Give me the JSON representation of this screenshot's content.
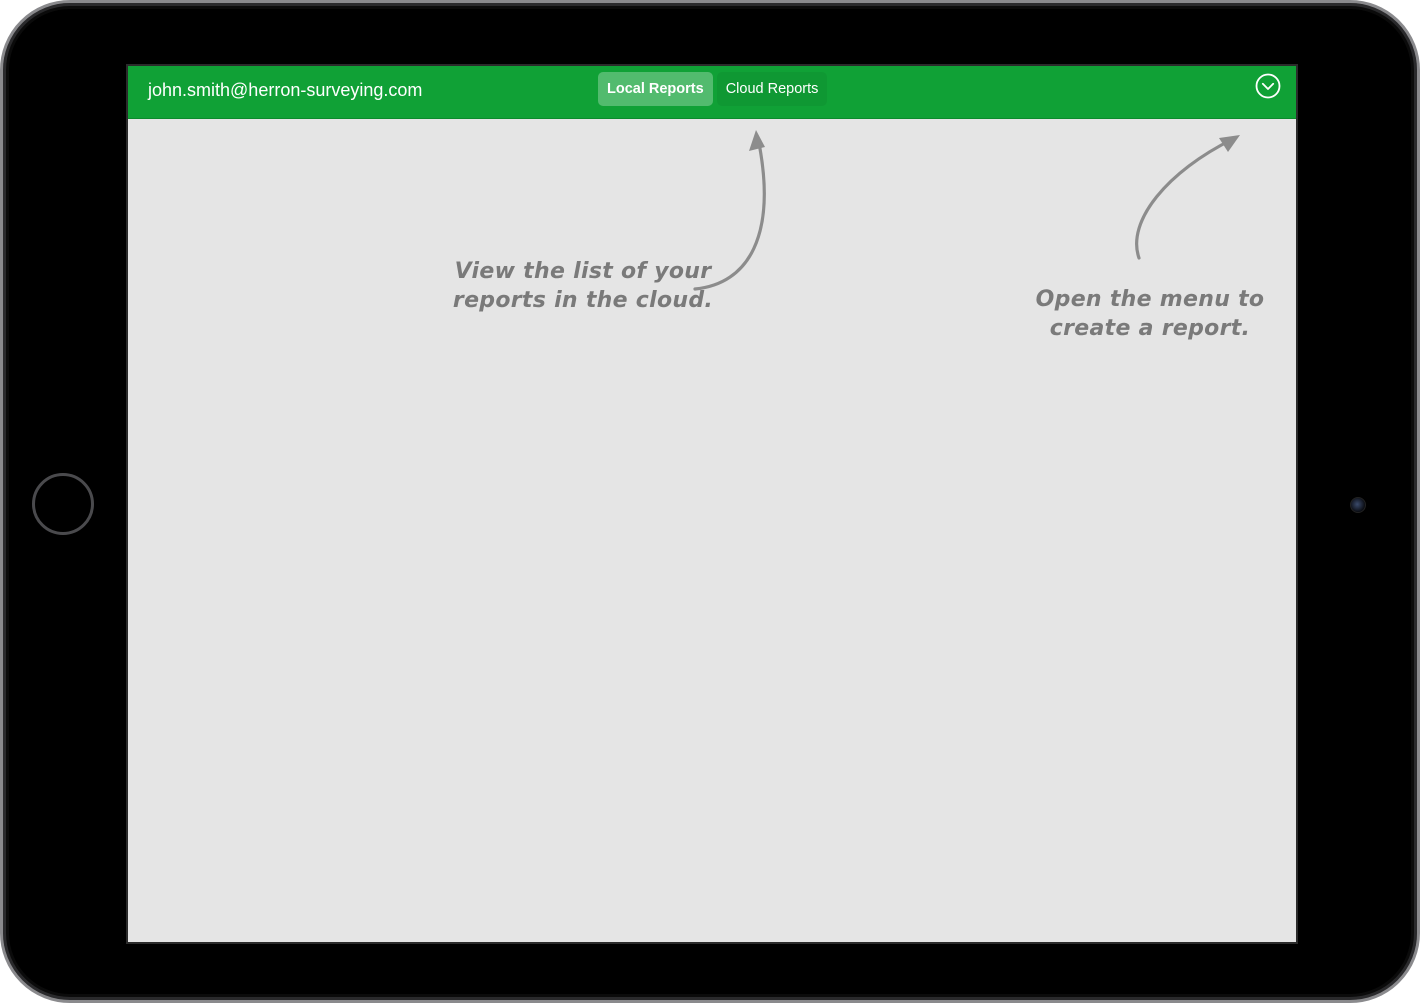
{
  "header": {
    "user_email": "john.smith@herron-surveying.com",
    "tabs": [
      {
        "label": "Local Reports",
        "selected": true
      },
      {
        "label": "Cloud Reports",
        "selected": false
      }
    ],
    "menu_icon": "chevron-down-circle-icon"
  },
  "annotations": {
    "cloud_reports": {
      "line1": "View the list of your",
      "line2": "reports in the cloud."
    },
    "menu": {
      "line1": "Open the menu to",
      "line2": "create a report."
    }
  },
  "colors": {
    "header_bg": "#10a136",
    "content_bg": "#e5e5e5",
    "annotation_text": "#7a7a7a"
  }
}
